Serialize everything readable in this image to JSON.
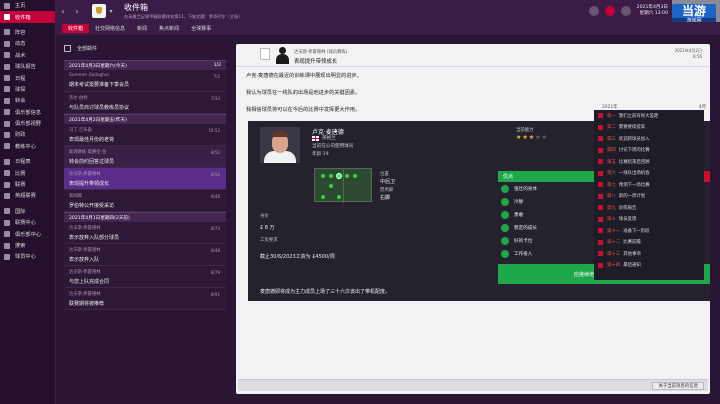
{
  "nav": {
    "items": [
      {
        "label": "主页",
        "active": false
      },
      {
        "label": "收件箱",
        "active": true
      },
      {
        "label": "阵容",
        "active": false
      },
      {
        "label": "动态",
        "active": false
      },
      {
        "label": "战术",
        "active": false
      },
      {
        "label": "球队报告",
        "active": false
      },
      {
        "label": "日程",
        "active": false
      },
      {
        "label": "球探",
        "active": false
      },
      {
        "label": "转会",
        "active": false
      },
      {
        "label": "俱乐部信息",
        "active": false
      },
      {
        "label": "俱乐部视野",
        "active": false
      },
      {
        "label": "财政",
        "active": false
      },
      {
        "label": "教练中心",
        "active": false
      },
      {
        "label": "日程表",
        "active": false
      },
      {
        "label": "比赛",
        "active": false
      },
      {
        "label": "联赛",
        "active": false
      },
      {
        "label": "英超联赛",
        "active": false
      },
      {
        "label": "国际",
        "active": false
      },
      {
        "label": "联赛中心",
        "active": false
      },
      {
        "label": "俱乐部中心",
        "active": false
      },
      {
        "label": "搜索",
        "active": false
      },
      {
        "label": "球员中心",
        "active": false
      }
    ]
  },
  "topbar": {
    "title": "收件箱",
    "subtitle": "在英格兰足球甲级联赛排名第11，下轮比赛：罗奇代尔（主场）",
    "date_line1": "2021年4月3日",
    "date_line2": "星期六 13:00",
    "continue_label": "继续"
  },
  "watermark": {
    "big": "当游",
    "small": "游戏网"
  },
  "subtabs": [
    "收件箱",
    "社交网络信息",
    "新闻",
    "焦点新闻",
    "全球赛事"
  ],
  "list_head": {
    "filter_label": "全部邮件"
  },
  "messages_day1": {
    "header": "2021年4月3日星期六(今天)",
    "count": "1/2",
    "items": [
      {
        "from": "Summer Gallagher",
        "subj": "期末考试需要准备下季会员",
        "time": "7/2"
      },
      {
        "from": "杰尔·伯特",
        "subj": "与队员商讨球员教练员协议",
        "time": "7/33"
      }
    ]
  },
  "messages_day2": {
    "header": "2021年4月2日星期五(昨天)",
    "count": "",
    "items": [
      {
        "from": "马丁·吉布森",
        "subj": "表现最佳月份的老将",
        "time": "16:52"
      },
      {
        "from": "助理教练·奥赛金-金",
        "subj": "转会前约回答过球员",
        "time": "8/52"
      },
      {
        "from": "达沃斯·弗雷德林",
        "subj": "表现提升带领成长",
        "time": "8/56"
      },
      {
        "from": "新闻稿",
        "subj": "罗伯特公开接受采访",
        "time": "8/48"
      }
    ]
  },
  "messages_day3": {
    "header": "2021年4月1日星期四(2天前)",
    "count": "",
    "items": [
      {
        "from": "达沃斯·弗雷德林",
        "subj": "表示放弃入队部分球员",
        "time": "8/74"
      },
      {
        "from": "达沃斯·弗雷德林",
        "subj": "表示放弃入队",
        "time": "8/48"
      },
      {
        "from": "达沃斯·弗雷德林",
        "subj": "与您上队完成合同",
        "time": "8/79"
      },
      {
        "from": "达沃斯·弗雷德林",
        "subj": "联赛期将被推荐",
        "time": "8/91"
      }
    ]
  },
  "panel": {
    "from": "达沃斯·弗雷德林 (球员教练)",
    "subject": "表现提升带领成长",
    "time_line1": "2021年4月2日",
    "time_line2": "8:56",
    "para1": "卢克·麦唐德在最近的训练课中展现出明显的进步。",
    "para2": "我认为球员在一线队的出场是他进步的关键因素。",
    "para3": "我相信球员将可以在今后的比赛中发挥更大作用。",
    "stat_left": "2021年",
    "stat_right": "4月"
  },
  "player": {
    "name": "卢克·麦唐德",
    "nationality": "英格兰",
    "club": "当前在公司使用球员",
    "position": "中后卫",
    "ability_label": "当前能力",
    "stars_on": "★★★",
    "stars_off": "★★",
    "lbl_age": "年龄",
    "val_age": "19",
    "lbl_value": "身价",
    "val_value": "£ 8 万",
    "lbl_salary": "工资要求",
    "val_salary": "截止30/6/2023工资为 £4500/周",
    "lbl_role": "位置",
    "val_role": "中后卫",
    "lbl_foot": "惯用脚",
    "val_foot": "右脚",
    "footer": "麦唐德即将成为主力成员上场了三十六次该出了带机配度。"
  },
  "strengths": {
    "title": "优点",
    "items": [
      "强壮的身体",
      "冷静",
      "勇敢",
      "稳定的成长",
      "好的卡位",
      "工作投入"
    ]
  },
  "weaknesses": {
    "title": "缺点",
    "items": [
      "一些技术问题",
      "缺乏速度",
      "缺少组织",
      "一般的传球",
      "与其他球员",
      "决断力不足"
    ]
  },
  "summary_label": "应继续培养，以求更多进步",
  "feed": {
    "items": [
      {
        "k": "第一",
        "t": "我们之前有很大差距"
      },
      {
        "k": "第二",
        "t": "需要继续提高"
      },
      {
        "k": "第三",
        "t": "欢迎新球员加入"
      },
      {
        "k": "第四",
        "t": "讨论下周的比赛"
      },
      {
        "k": "第五",
        "t": "比赛结束后回顾"
      },
      {
        "k": "第六",
        "t": "一线队出场机会"
      },
      {
        "k": "第七",
        "t": "预测下一场比赛"
      },
      {
        "k": "第八",
        "t": "新的一周计划"
      },
      {
        "k": "第九",
        "t": "训练报告"
      },
      {
        "k": "第十",
        "t": "球员反馈"
      },
      {
        "k": "第十一",
        "t": "准备下一阶段"
      },
      {
        "k": "第十二",
        "t": "比赛前瞻"
      },
      {
        "k": "第十三",
        "t": "其他事项"
      },
      {
        "k": "第十四",
        "t": "最后通知"
      }
    ]
  },
  "bottom": {
    "next_label": "关于当前消息的信息"
  },
  "colors": {
    "accent": "#c4003a",
    "positive": "#1fa84a",
    "negative": "#c8102e"
  }
}
